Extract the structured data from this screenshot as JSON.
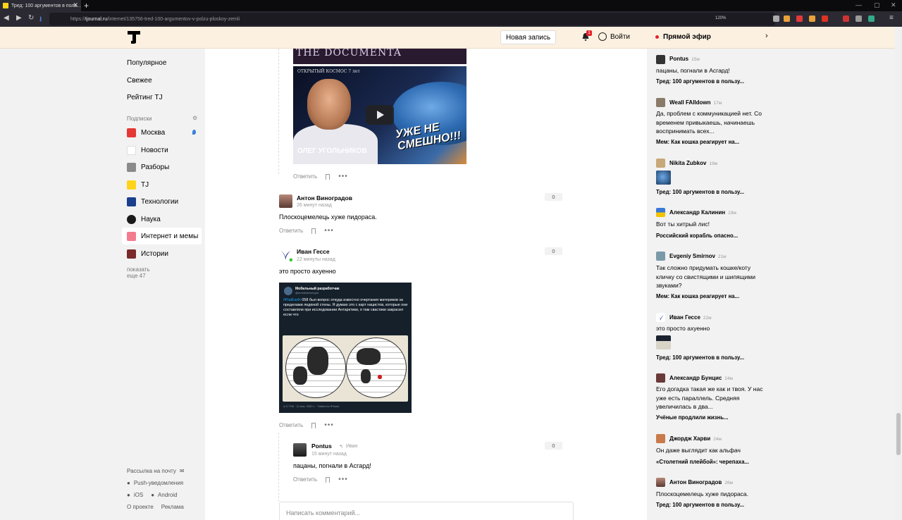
{
  "browser": {
    "tab_title": "Тред: 100 аргументов в поль...",
    "url_prefix": "https://",
    "url_host": "tjournal.ru",
    "url_path": "/internet/135756-tred-100-argumentov-v-polzu-ploskoy-zemli",
    "zoom": "120%"
  },
  "header": {
    "new_post": "Новая запись",
    "notif_count": "1",
    "login": "Войти",
    "live": "Прямой эфир"
  },
  "sidebar": {
    "main": [
      "Популярное",
      "Свежее",
      "Рейтинг TJ"
    ],
    "subs_caption": "Подписки",
    "subs": [
      {
        "label": "Москва",
        "color": "#e53935"
      },
      {
        "label": "Новости",
        "color": "#ffffff"
      },
      {
        "label": "Разборы",
        "color": "#8a8a8a"
      },
      {
        "label": "TJ",
        "color": "#ffd31a"
      },
      {
        "label": "Технологии",
        "color": "#1b3f8c"
      },
      {
        "label": "Наука",
        "color": "#1a1a1a"
      },
      {
        "label": "Интернет и мемы",
        "color": "#f27c8e"
      },
      {
        "label": "Истории",
        "color": "#7a2a2a"
      }
    ],
    "show_more": "показать еще 47",
    "footer": {
      "newsletter": "Рассылка на почту",
      "push": "Push-уведомления",
      "ios": "iOS",
      "android": "Android",
      "about": "О проекте",
      "ads": "Реклама"
    }
  },
  "content": {
    "video": {
      "top_text": "THE DOCUMENTA",
      "cosmos": "ОТКРЫТЫЙ КОСМОС 7 лет",
      "big": "УЖЕ НЕ СМЕШНО!!!",
      "name": "ОЛЕГ УГОЛЬНИКОВ"
    },
    "reply_label": "Ответить",
    "comments": [
      {
        "author": "Антон Виноградов",
        "time": "26 минут назад",
        "text": "Плоскоцемелець хуже пидораса.",
        "score": "0"
      },
      {
        "author": "Иван Гессе",
        "time": "22 минуты назад",
        "text": "это просто ахуенно",
        "score": "0"
      },
      {
        "author": "Pontus",
        "reply_to": "Иван",
        "time": "15 минут назад",
        "text": "пацаны, погнали в Асгард!",
        "score": "0"
      }
    ],
    "tweet": {
      "name": "Мобильный разработчик",
      "handle": "@mobiledeveloper",
      "hashtag": "#FlatEarth",
      "text": " 058 был вопрос откуда известно очертания материков за пределами ледяной стены. Я думаю это с карт нацистов, которые они составляли при исследовании Антарктики, я там свастики закрасил если что",
      "footer": "4:17 PM · 12 янв. 2020 г. · Twitter for iPhone"
    },
    "compose_placeholder": "Написать комментарий..."
  },
  "live_feed": [
    {
      "name": "Pontus",
      "time": "15м",
      "text": "пацаны, погнали в Асгард!",
      "link": "Тред: 100 аргументов в пользу..."
    },
    {
      "name": "Weall FAlldown",
      "time": "17м",
      "text": "Да, проблем с коммуникацией нет. Со временем привыкаешь, начинаешь воспринимать всех...",
      "link": "Мем: Как кошка реагирует на..."
    },
    {
      "name": "Nikita Zubkov",
      "time": "19м",
      "text": "",
      "link": "Тред: 100 аргументов в пользу..."
    },
    {
      "name": "Александр Калинин",
      "time": "19м",
      "text": "Вот ты хитрый лис!",
      "link": "Российский корабль опасно..."
    },
    {
      "name": "Evgeniy Smirnov",
      "time": "21м",
      "text": "Так сложно придумать кошке/коту кличку со свистящими и шипящими звуками?",
      "link": "Мем: Как кошка реагирует на..."
    },
    {
      "name": "Иван Гессе",
      "time": "22м",
      "text": "это просто ахуенно",
      "link": "Тред: 100 аргументов в пользу..."
    },
    {
      "name": "Александр Бунцис",
      "time": "24м",
      "text": "Его догадка такая же как и твоя. У нас уже есть параллель. Средняя увеличилась в два...",
      "link": "Учёные продлили жизнь..."
    },
    {
      "name": "Джордж Харви",
      "time": "24м",
      "text": "Он даже выглядит как альфач",
      "link": "«Столетний плейбой»: черепаха..."
    },
    {
      "name": "Антон Виноградов",
      "time": "26м",
      "text": "Плоскоцемелець хуже пидораса.",
      "link": "Тред: 100 аргументов в пользу..."
    }
  ]
}
